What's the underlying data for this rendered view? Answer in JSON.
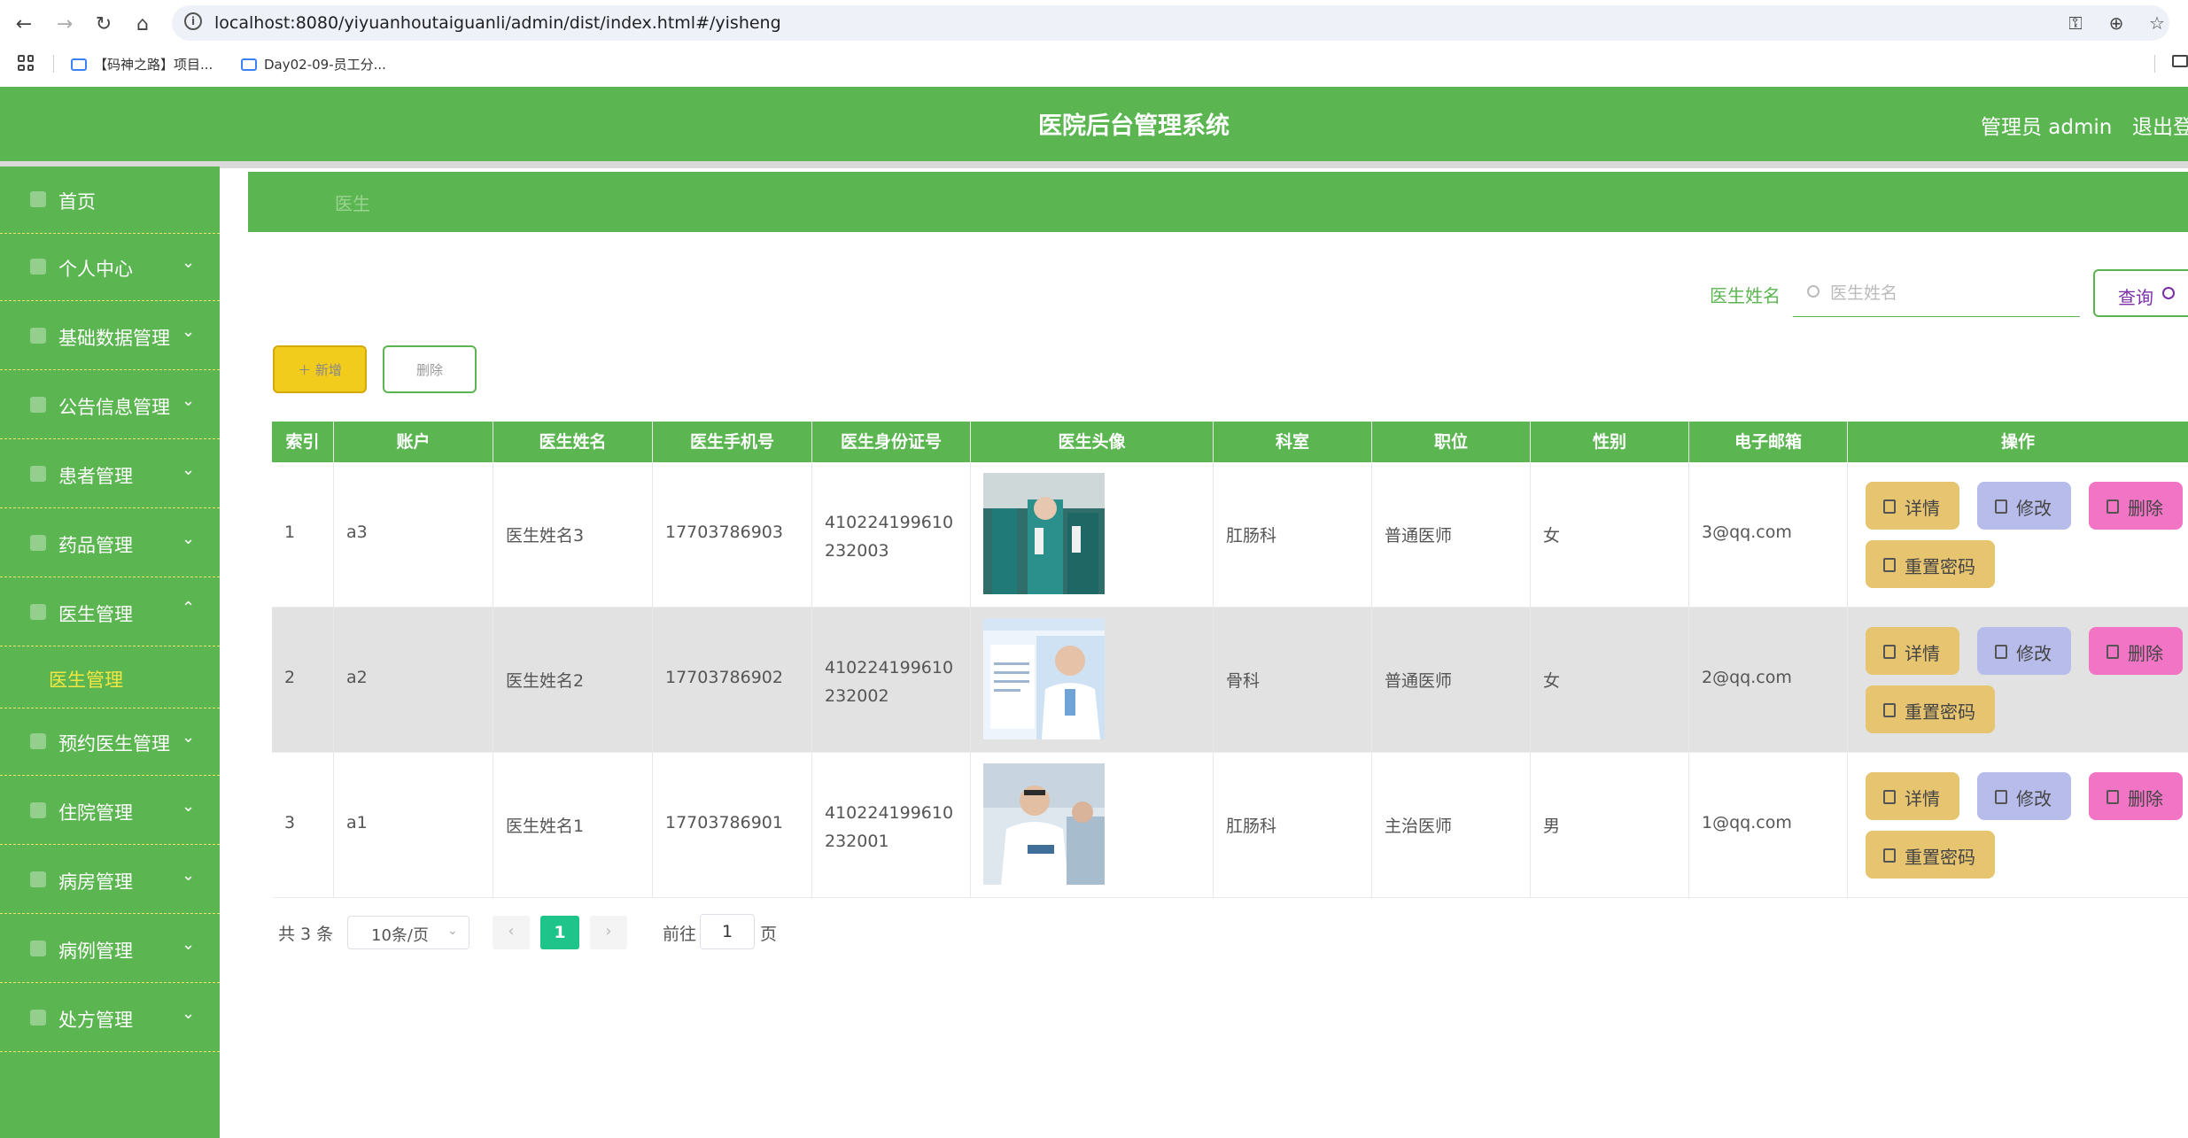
{
  "browser": {
    "url": "localhost:8080/yiyuanhoutaiguanli/admin/dist/index.html#/yisheng",
    "bookmarks": [
      "【码神之路】项目...",
      "Day02-09-员工分..."
    ]
  },
  "header": {
    "title": "医院后台管理系统",
    "user": "管理员 admin",
    "logout": "退出登"
  },
  "sidebar": {
    "items": [
      {
        "label": "首页",
        "arrow": ""
      },
      {
        "label": "个人中心",
        "arrow": "⌄"
      },
      {
        "label": "基础数据管理",
        "arrow": "⌄"
      },
      {
        "label": "公告信息管理",
        "arrow": "⌄"
      },
      {
        "label": "患者管理",
        "arrow": "⌄"
      },
      {
        "label": "药品管理",
        "arrow": "⌄"
      },
      {
        "label": "医生管理",
        "arrow": "⌃"
      },
      {
        "label": "预约医生管理",
        "arrow": "⌄"
      },
      {
        "label": "住院管理",
        "arrow": "⌄"
      },
      {
        "label": "病房管理",
        "arrow": "⌄"
      },
      {
        "label": "病例管理",
        "arrow": "⌄"
      },
      {
        "label": "处方管理",
        "arrow": "⌄"
      }
    ],
    "submenu_active": "医生管理"
  },
  "breadcrumb": "医生",
  "search": {
    "label": "医生姓名",
    "placeholder": "医生姓名",
    "button": "查询"
  },
  "actions": {
    "add": "＋ 新增",
    "delete": "删除"
  },
  "table": {
    "headers": [
      "索引",
      "账户",
      "医生姓名",
      "医生手机号",
      "医生身份证号",
      "医生头像",
      "科室",
      "职位",
      "性别",
      "电子邮箱",
      "操作"
    ],
    "rows": [
      {
        "index": "1",
        "account": "a3",
        "name": "医生姓名3",
        "phone": "17703786903",
        "id_number": "410224199610232003",
        "dept": "肛肠科",
        "position": "普通医师",
        "gender": "女",
        "email": "3@qq.com"
      },
      {
        "index": "2",
        "account": "a2",
        "name": "医生姓名2",
        "phone": "17703786902",
        "id_number": "410224199610232002",
        "dept": "骨科",
        "position": "普通医师",
        "gender": "女",
        "email": "2@qq.com"
      },
      {
        "index": "3",
        "account": "a1",
        "name": "医生姓名1",
        "phone": "17703786901",
        "id_number": "410224199610232001",
        "dept": "肛肠科",
        "position": "主治医师",
        "gender": "男",
        "email": "1@qq.com"
      }
    ],
    "ops": {
      "detail": "详情",
      "edit": "修改",
      "delete": "删除",
      "reset": "重置密码"
    }
  },
  "pagination": {
    "total": "共 3 条",
    "page_size": "10条/页",
    "current": "1",
    "goto_label": "前往",
    "goto_value": "1",
    "page_unit": "页"
  },
  "colors": {
    "primary": "#5bb651",
    "accent_yellow": "#f2cc1c",
    "detail_btn": "#e7c470",
    "edit_btn": "#b7bcea",
    "delete_btn": "#f274c5",
    "page_active": "#1ec48a"
  }
}
